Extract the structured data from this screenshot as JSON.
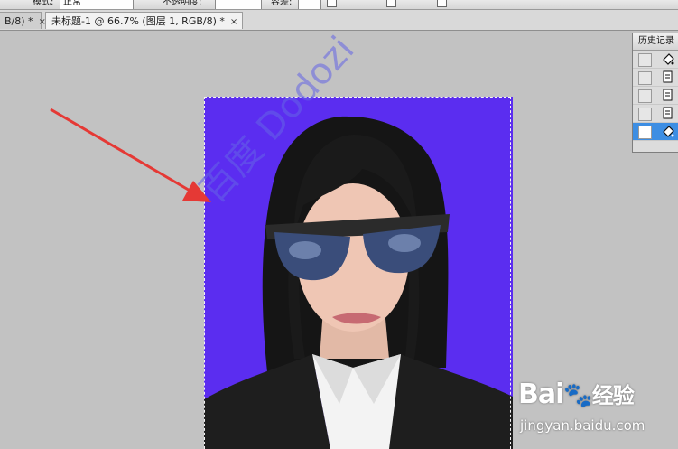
{
  "options_bar": {
    "mode_label": "模式:",
    "mode_value": "正常",
    "opacity_label": "不透明度:",
    "tolerance_label": "容差:"
  },
  "tabs": [
    {
      "label": "B/8) *",
      "close": "×"
    },
    {
      "label": "未标题-1 @ 66.7% (图层 1, RGB/8) *",
      "close": "×"
    }
  ],
  "history_panel": {
    "title": "历史记录",
    "items": [
      {
        "icon": "paint-bucket-icon",
        "selected": false
      },
      {
        "icon": "document-state-icon",
        "selected": false
      },
      {
        "icon": "document-state-icon",
        "selected": false
      },
      {
        "icon": "document-state-icon",
        "selected": false
      },
      {
        "icon": "paint-bucket-icon",
        "selected": true
      }
    ]
  },
  "canvas": {
    "background_color": "#5b2df0",
    "content": "portrait-photo"
  },
  "watermark": {
    "text": "百度  Dodozi",
    "brand": "Bai",
    "brand_suffix": "经验",
    "url": "jingyan.baidu.com"
  },
  "annotation": {
    "arrow_color": "#e53935"
  }
}
